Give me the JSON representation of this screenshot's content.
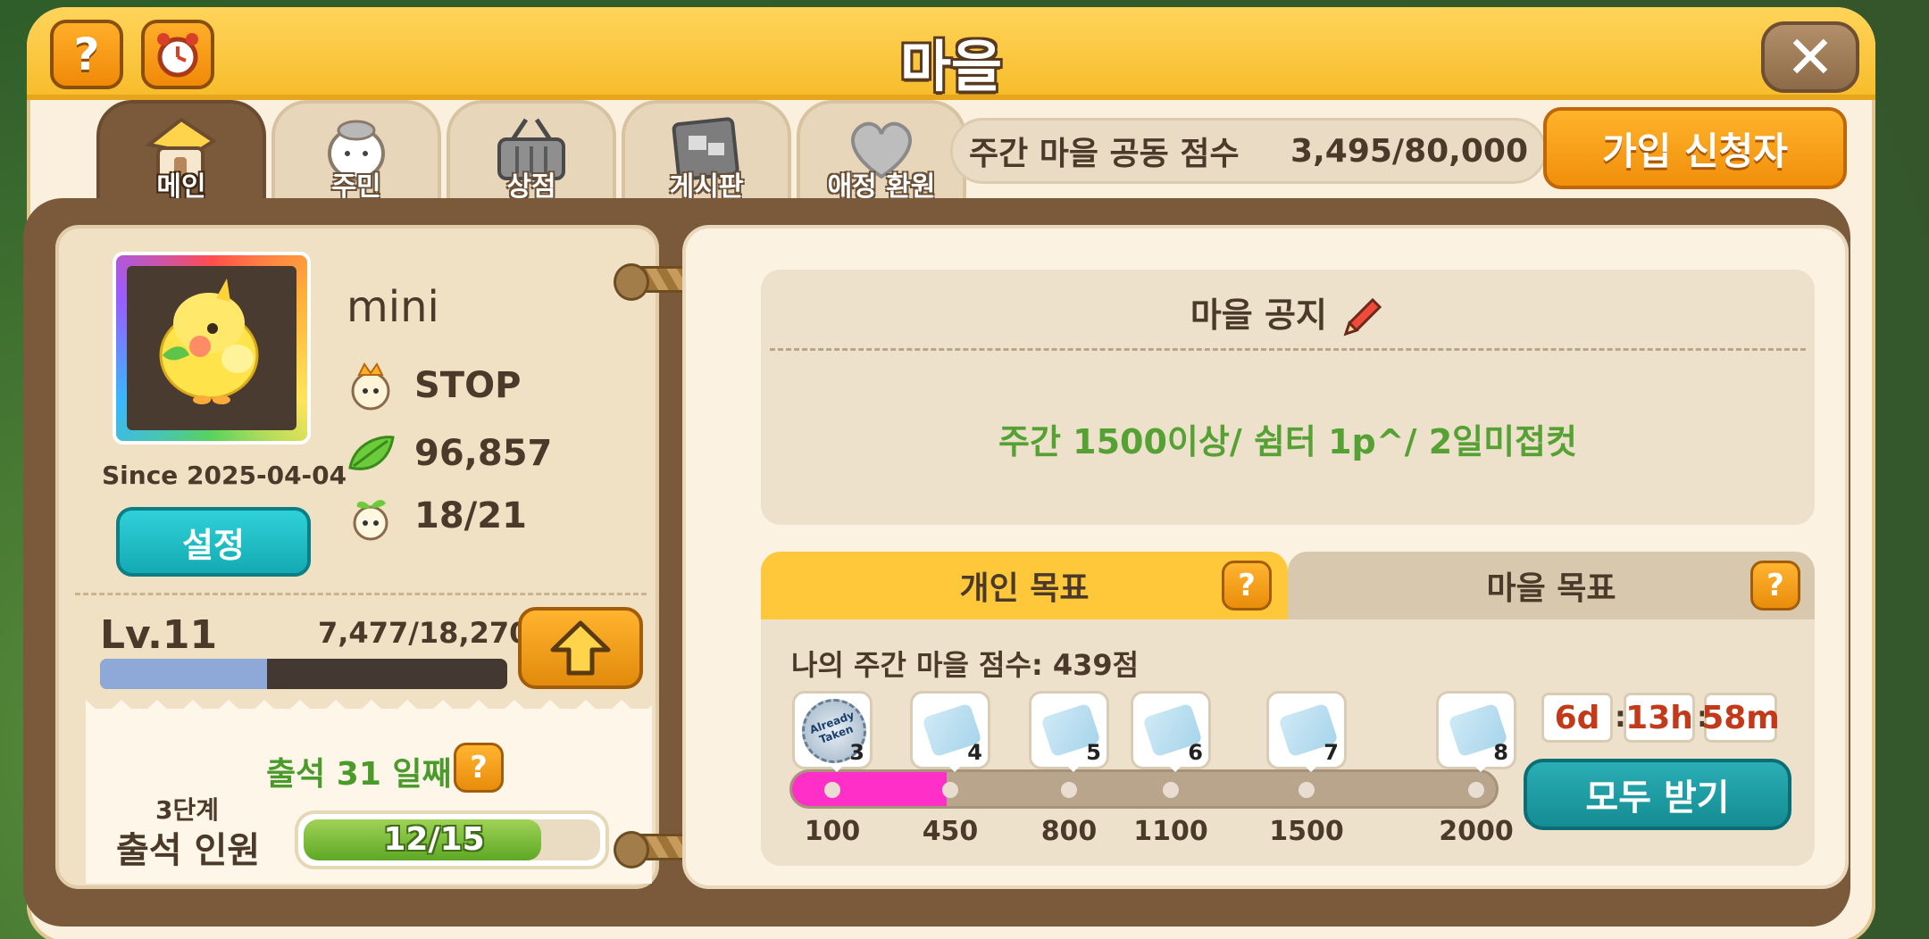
{
  "window": {
    "title": "마을",
    "help_icon": "help-icon",
    "alarm_icon": "alarm-clock-icon",
    "close_label": "✕",
    "colors": {
      "title_bar": "#ffd45a",
      "board": "#7b5a3c",
      "accent_orange": "#f39210",
      "accent_teal": "#1cb3bb",
      "progress_pink": "#ff2fc8"
    }
  },
  "tabs": [
    {
      "label": "메인",
      "icon": "house-icon",
      "active": true
    },
    {
      "label": "주민",
      "icon": "resident-icon",
      "active": false
    },
    {
      "label": "상점",
      "icon": "basket-icon",
      "active": false
    },
    {
      "label": "게시판",
      "icon": "board-icon",
      "active": false
    },
    {
      "label": "애정 환원",
      "icon": "heart-icon",
      "active": false
    }
  ],
  "header": {
    "weekly_score_label": "주간 마을 공동 점수",
    "weekly_score_value": "3,495/80,000",
    "join_requests_label": "가입 신청자"
  },
  "profile": {
    "name": "mini",
    "avatar_icon": "yellow-bird-avatar-icon",
    "stats": [
      {
        "icon": "crown-character-icon",
        "value": "STOP"
      },
      {
        "icon": "leaf-icon",
        "value": "96,857"
      },
      {
        "icon": "sprout-character-icon",
        "value": "18/21"
      }
    ],
    "since": "Since 2025-04-04",
    "settings_label": "설정",
    "level": "Lv.11",
    "exp_text": "7,477/18,270",
    "exp_fraction": 0.409,
    "level_up_icon": "arrow-up-icon"
  },
  "attendance": {
    "title": "출석 31 일째",
    "stage": "3단계",
    "label": "출석 인원",
    "value": "12/15",
    "fraction": 0.8
  },
  "notice": {
    "title": "마을 공지",
    "edit_icon": "pencil-icon",
    "text": "주간 1500이상/ 쉼터 1p^/ 2일미접컷"
  },
  "goals": {
    "personal_tab": "개인 목표",
    "village_tab": "마을 목표",
    "my_score": "나의 주간 마을 점수: 439점",
    "progress_fraction": 0.22,
    "milestones": [
      {
        "num": "3",
        "threshold": "100",
        "reward": "already-taken-badge-icon",
        "badge_text": "Already Taken"
      },
      {
        "num": "4",
        "threshold": "450",
        "reward": "ticket-icon"
      },
      {
        "num": "5",
        "threshold": "800",
        "reward": "ticket-icon"
      },
      {
        "num": "6",
        "threshold": "1100",
        "reward": "ticket-icon"
      },
      {
        "num": "7",
        "threshold": "1500",
        "reward": "ticket-icon"
      },
      {
        "num": "8",
        "threshold": "2000",
        "reward": "ticket-icon"
      }
    ],
    "timer": {
      "days": "6d",
      "hours": "13h",
      "minutes": "58m"
    },
    "claim_all_label": "모두 받기"
  }
}
